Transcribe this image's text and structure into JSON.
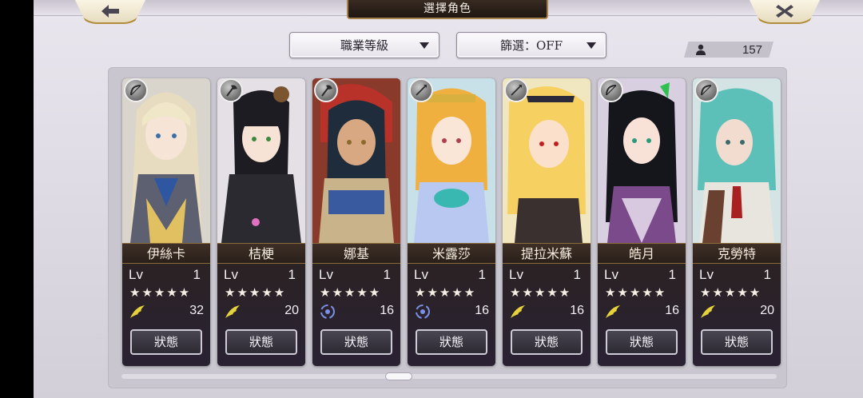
{
  "header": {
    "title": "選擇角色",
    "back_icon": "back-arrow-icon",
    "close_icon": "close-icon"
  },
  "controls": {
    "class_sort_label": "職業等級",
    "filter_label": "篩選：OFF",
    "character_count": "157"
  },
  "colors": {
    "background": "#e3dfe8",
    "card_dark": "#2d2322",
    "gold_border": "#b08c3c"
  },
  "characters": [
    {
      "name": "伊絲卡",
      "lv_label": "Lv",
      "level": "1",
      "stars": "★★★★★",
      "stat_icon": "wing-feather-icon",
      "stat": "32",
      "status_label": "狀態",
      "class_icon": "bow-icon"
    },
    {
      "name": "桔梗",
      "lv_label": "Lv",
      "level": "1",
      "stars": "★★★★★",
      "stat_icon": "wing-feather-icon",
      "stat": "20",
      "status_label": "狀態",
      "class_icon": "axe-icon"
    },
    {
      "name": "娜基",
      "lv_label": "Lv",
      "level": "1",
      "stars": "★★★★★",
      "stat_icon": "vortex-icon",
      "stat": "16",
      "status_label": "狀態",
      "class_icon": "axe-icon"
    },
    {
      "name": "米露莎",
      "lv_label": "Lv",
      "level": "1",
      "stars": "★★★★★",
      "stat_icon": "vortex-icon",
      "stat": "16",
      "status_label": "狀態",
      "class_icon": "spear-icon"
    },
    {
      "name": "提拉米蘇",
      "lv_label": "Lv",
      "level": "1",
      "stars": "★★★★★",
      "stat_icon": "wing-feather-icon",
      "stat": "16",
      "status_label": "狀態",
      "class_icon": "spear-icon"
    },
    {
      "name": "皓月",
      "lv_label": "Lv",
      "level": "1",
      "stars": "★★★★★",
      "stat_icon": "wing-feather-icon",
      "stat": "16",
      "status_label": "狀態",
      "class_icon": "bow-icon"
    },
    {
      "name": "克勞特",
      "lv_label": "Lv",
      "level": "1",
      "stars": "★★★★★",
      "stat_icon": "wing-feather-icon",
      "stat": "20",
      "status_label": "狀態",
      "class_icon": "bow-icon"
    }
  ]
}
